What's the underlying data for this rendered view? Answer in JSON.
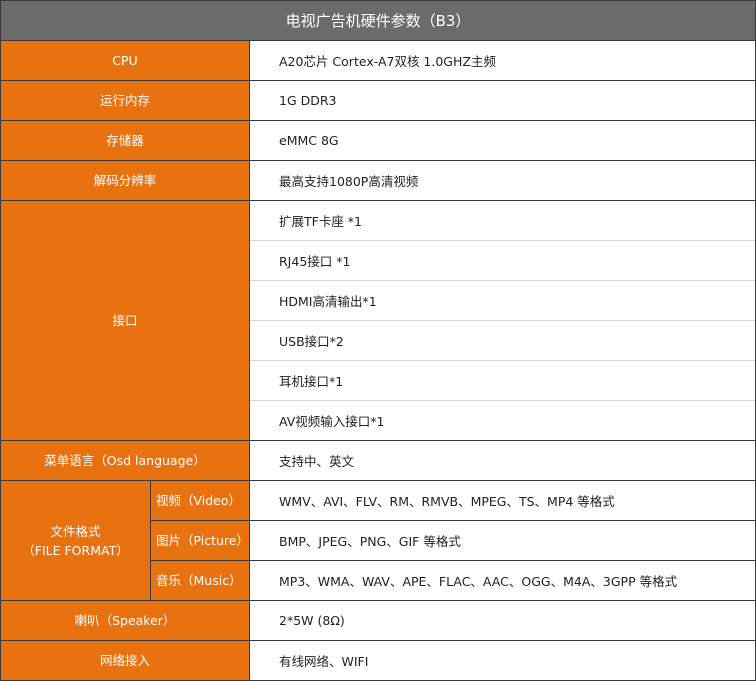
{
  "title": "电视广告机硬件参数（B3）",
  "rows": {
    "cpu": {
      "label": "CPU",
      "value": "A20芯片 Cortex-A7双核 1.0GHZ主频"
    },
    "ram": {
      "label": "运行内存",
      "value": "1G DDR3"
    },
    "storage": {
      "label": "存储器",
      "value": "eMMC 8G"
    },
    "resolution": {
      "label": "解码分辨率",
      "value": "最高支持1080P高清视频"
    },
    "interfaces": {
      "label": "接口",
      "values": [
        "扩展TF卡座 *1",
        "RJ45接口 *1",
        "HDMI高清输出*1",
        "USB接口*2",
        "耳机接口*1",
        "AV视频输入接口*1"
      ]
    },
    "osd": {
      "label": "菜单语言（Osd language）",
      "value": "支持中、英文"
    },
    "file_format": {
      "label_line1": "文件格式",
      "label_line2": "（FILE FORMAT）",
      "video": {
        "label": "视频（Video）",
        "value": "WMV、AVI、FLV、RM、RMVB、MPEG、TS、MP4 等格式"
      },
      "picture": {
        "label": "图片（Picture）",
        "value": "BMP、JPEG、PNG、GIF 等格式"
      },
      "music": {
        "label": "音乐（Music）",
        "value": "MP3、WMA、WAV、APE、FLAC、AAC、OGG、M4A、3GPP 等格式"
      }
    },
    "speaker": {
      "label": "喇叭（Speaker）",
      "value": "2*5W (8Ω)"
    },
    "network": {
      "label": "网络接入",
      "value": "有线网络、WIFI"
    }
  }
}
